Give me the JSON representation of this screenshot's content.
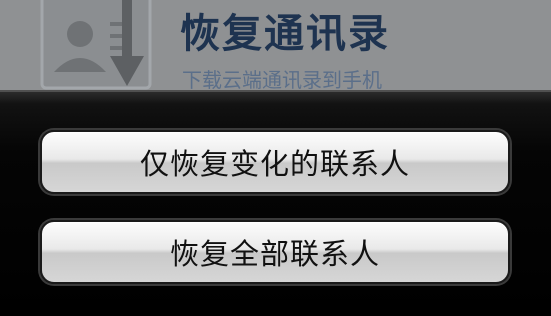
{
  "background_screen": {
    "title": "恢复通讯录",
    "subtitle": "下载云端通讯录到手机",
    "icon": "contact-download-icon"
  },
  "action_sheet": {
    "restore_changed_label": "仅恢复变化的联系人",
    "restore_all_label": "恢复全部联系人"
  }
}
